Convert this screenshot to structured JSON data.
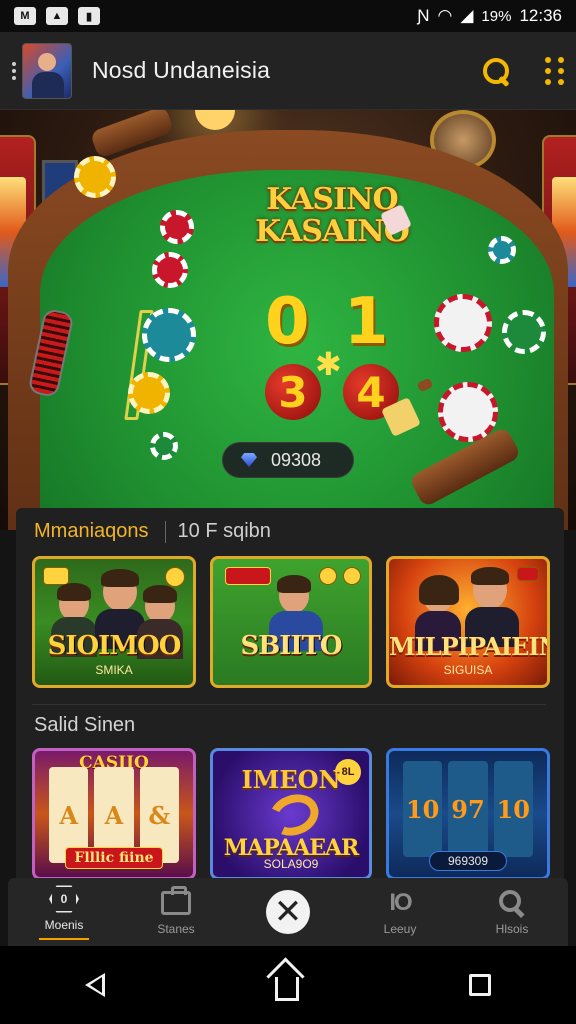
{
  "status_bar": {
    "battery": "19%",
    "time": "12:36"
  },
  "app_bar": {
    "title": "Nosd Undaneisia"
  },
  "hero": {
    "logo_line1": "KASINO",
    "logo_line2": "KASAINO",
    "numbers_top": "0 1",
    "red_balls": [
      "3",
      "4"
    ],
    "balance": "09308"
  },
  "section_featured": {
    "title": "Mmaniaqons",
    "subtitle": "10 F sqibn",
    "cards": [
      {
        "title": "SIOIMOO",
        "subtitle": "SMIKA"
      },
      {
        "title": "SBIITO",
        "subtitle": ""
      },
      {
        "title": "MILPIPAIEIN",
        "subtitle": "SIGUISA"
      }
    ]
  },
  "section_slots": {
    "title": "Salid Sinen",
    "cards": [
      {
        "top_label": "CASIIO",
        "bottom_label": "Flllic fiine",
        "reels": [
          "A",
          "A",
          "&"
        ]
      },
      {
        "top_label": "IMEON",
        "title": "MAPAAEAR",
        "subtitle": "SOLA9O9",
        "badge": "8L"
      },
      {
        "reels": [
          "10",
          "97",
          "10"
        ],
        "bottom_label": "969309"
      }
    ]
  },
  "tabs": [
    {
      "label": "Moenis",
      "active": true
    },
    {
      "label": "Stanes",
      "active": false
    },
    {
      "label": "",
      "active": false
    },
    {
      "label": "Leeuy",
      "active": false
    },
    {
      "label": "Hlsois",
      "active": false
    }
  ],
  "colors": {
    "accent": "#f5b800",
    "section_title": "#f1b42a",
    "felt": "#1f8f30"
  }
}
